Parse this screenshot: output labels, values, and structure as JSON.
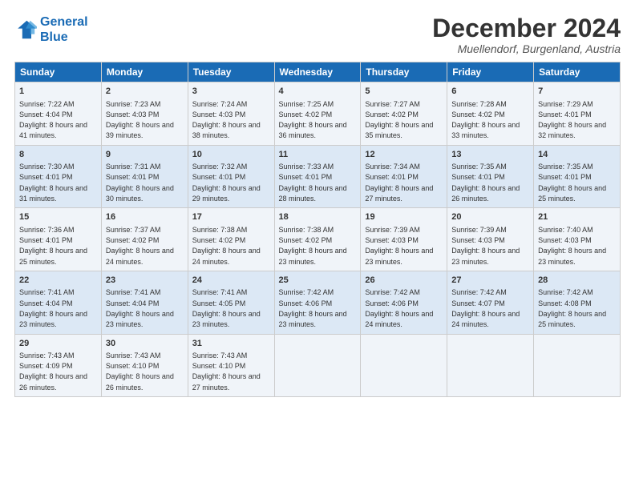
{
  "logo": {
    "line1": "General",
    "line2": "Blue"
  },
  "title": "December 2024",
  "subtitle": "Muellendorf, Burgenland, Austria",
  "headers": [
    "Sunday",
    "Monday",
    "Tuesday",
    "Wednesday",
    "Thursday",
    "Friday",
    "Saturday"
  ],
  "weeks": [
    [
      {
        "day": "1",
        "sunrise": "Sunrise: 7:22 AM",
        "sunset": "Sunset: 4:04 PM",
        "daylight": "Daylight: 8 hours and 41 minutes."
      },
      {
        "day": "2",
        "sunrise": "Sunrise: 7:23 AM",
        "sunset": "Sunset: 4:03 PM",
        "daylight": "Daylight: 8 hours and 39 minutes."
      },
      {
        "day": "3",
        "sunrise": "Sunrise: 7:24 AM",
        "sunset": "Sunset: 4:03 PM",
        "daylight": "Daylight: 8 hours and 38 minutes."
      },
      {
        "day": "4",
        "sunrise": "Sunrise: 7:25 AM",
        "sunset": "Sunset: 4:02 PM",
        "daylight": "Daylight: 8 hours and 36 minutes."
      },
      {
        "day": "5",
        "sunrise": "Sunrise: 7:27 AM",
        "sunset": "Sunset: 4:02 PM",
        "daylight": "Daylight: 8 hours and 35 minutes."
      },
      {
        "day": "6",
        "sunrise": "Sunrise: 7:28 AM",
        "sunset": "Sunset: 4:02 PM",
        "daylight": "Daylight: 8 hours and 33 minutes."
      },
      {
        "day": "7",
        "sunrise": "Sunrise: 7:29 AM",
        "sunset": "Sunset: 4:01 PM",
        "daylight": "Daylight: 8 hours and 32 minutes."
      }
    ],
    [
      {
        "day": "8",
        "sunrise": "Sunrise: 7:30 AM",
        "sunset": "Sunset: 4:01 PM",
        "daylight": "Daylight: 8 hours and 31 minutes."
      },
      {
        "day": "9",
        "sunrise": "Sunrise: 7:31 AM",
        "sunset": "Sunset: 4:01 PM",
        "daylight": "Daylight: 8 hours and 30 minutes."
      },
      {
        "day": "10",
        "sunrise": "Sunrise: 7:32 AM",
        "sunset": "Sunset: 4:01 PM",
        "daylight": "Daylight: 8 hours and 29 minutes."
      },
      {
        "day": "11",
        "sunrise": "Sunrise: 7:33 AM",
        "sunset": "Sunset: 4:01 PM",
        "daylight": "Daylight: 8 hours and 28 minutes."
      },
      {
        "day": "12",
        "sunrise": "Sunrise: 7:34 AM",
        "sunset": "Sunset: 4:01 PM",
        "daylight": "Daylight: 8 hours and 27 minutes."
      },
      {
        "day": "13",
        "sunrise": "Sunrise: 7:35 AM",
        "sunset": "Sunset: 4:01 PM",
        "daylight": "Daylight: 8 hours and 26 minutes."
      },
      {
        "day": "14",
        "sunrise": "Sunrise: 7:35 AM",
        "sunset": "Sunset: 4:01 PM",
        "daylight": "Daylight: 8 hours and 25 minutes."
      }
    ],
    [
      {
        "day": "15",
        "sunrise": "Sunrise: 7:36 AM",
        "sunset": "Sunset: 4:01 PM",
        "daylight": "Daylight: 8 hours and 25 minutes."
      },
      {
        "day": "16",
        "sunrise": "Sunrise: 7:37 AM",
        "sunset": "Sunset: 4:02 PM",
        "daylight": "Daylight: 8 hours and 24 minutes."
      },
      {
        "day": "17",
        "sunrise": "Sunrise: 7:38 AM",
        "sunset": "Sunset: 4:02 PM",
        "daylight": "Daylight: 8 hours and 24 minutes."
      },
      {
        "day": "18",
        "sunrise": "Sunrise: 7:38 AM",
        "sunset": "Sunset: 4:02 PM",
        "daylight": "Daylight: 8 hours and 23 minutes."
      },
      {
        "day": "19",
        "sunrise": "Sunrise: 7:39 AM",
        "sunset": "Sunset: 4:03 PM",
        "daylight": "Daylight: 8 hours and 23 minutes."
      },
      {
        "day": "20",
        "sunrise": "Sunrise: 7:39 AM",
        "sunset": "Sunset: 4:03 PM",
        "daylight": "Daylight: 8 hours and 23 minutes."
      },
      {
        "day": "21",
        "sunrise": "Sunrise: 7:40 AM",
        "sunset": "Sunset: 4:03 PM",
        "daylight": "Daylight: 8 hours and 23 minutes."
      }
    ],
    [
      {
        "day": "22",
        "sunrise": "Sunrise: 7:41 AM",
        "sunset": "Sunset: 4:04 PM",
        "daylight": "Daylight: 8 hours and 23 minutes."
      },
      {
        "day": "23",
        "sunrise": "Sunrise: 7:41 AM",
        "sunset": "Sunset: 4:04 PM",
        "daylight": "Daylight: 8 hours and 23 minutes."
      },
      {
        "day": "24",
        "sunrise": "Sunrise: 7:41 AM",
        "sunset": "Sunset: 4:05 PM",
        "daylight": "Daylight: 8 hours and 23 minutes."
      },
      {
        "day": "25",
        "sunrise": "Sunrise: 7:42 AM",
        "sunset": "Sunset: 4:06 PM",
        "daylight": "Daylight: 8 hours and 23 minutes."
      },
      {
        "day": "26",
        "sunrise": "Sunrise: 7:42 AM",
        "sunset": "Sunset: 4:06 PM",
        "daylight": "Daylight: 8 hours and 24 minutes."
      },
      {
        "day": "27",
        "sunrise": "Sunrise: 7:42 AM",
        "sunset": "Sunset: 4:07 PM",
        "daylight": "Daylight: 8 hours and 24 minutes."
      },
      {
        "day": "28",
        "sunrise": "Sunrise: 7:42 AM",
        "sunset": "Sunset: 4:08 PM",
        "daylight": "Daylight: 8 hours and 25 minutes."
      }
    ],
    [
      {
        "day": "29",
        "sunrise": "Sunrise: 7:43 AM",
        "sunset": "Sunset: 4:09 PM",
        "daylight": "Daylight: 8 hours and 26 minutes."
      },
      {
        "day": "30",
        "sunrise": "Sunrise: 7:43 AM",
        "sunset": "Sunset: 4:10 PM",
        "daylight": "Daylight: 8 hours and 26 minutes."
      },
      {
        "day": "31",
        "sunrise": "Sunrise: 7:43 AM",
        "sunset": "Sunset: 4:10 PM",
        "daylight": "Daylight: 8 hours and 27 minutes."
      },
      null,
      null,
      null,
      null
    ]
  ]
}
